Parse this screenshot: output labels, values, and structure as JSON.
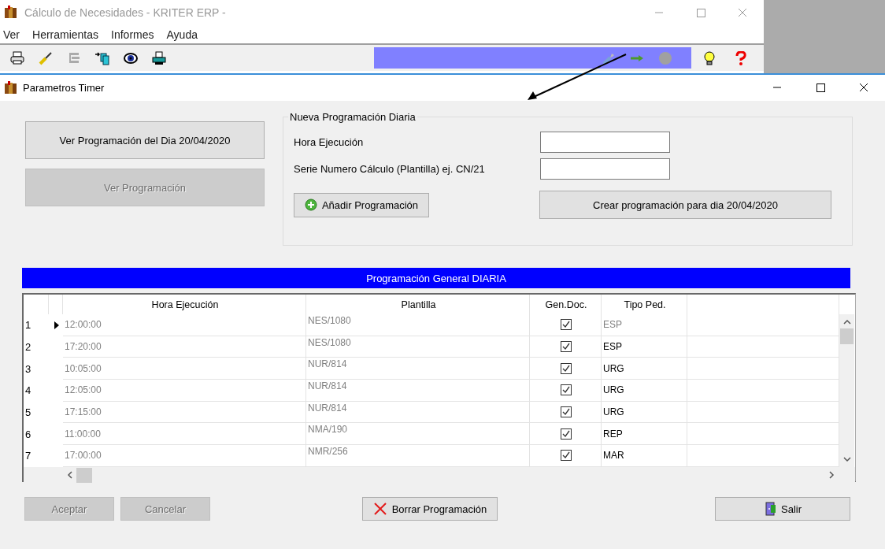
{
  "app": {
    "title": "Cálculo de Necesidades - KRITER ERP -",
    "menu": [
      {
        "label": "Ver"
      },
      {
        "label": "Herramientas"
      },
      {
        "label": "Informes"
      },
      {
        "label": "Ayuda"
      }
    ]
  },
  "dialog": {
    "title": "Parametros Timer",
    "left_buttons": [
      {
        "label": "Ver Programación del Dia 20/04/2020",
        "disabled": false
      },
      {
        "label": "Ver Programación",
        "disabled": true
      }
    ],
    "group": {
      "title": "Nueva Programación Diaria",
      "fields": [
        {
          "label": "Hora Ejecución"
        },
        {
          "label": "Serie Numero Cálculo (Plantilla) ej. CN/21"
        }
      ],
      "add_button": "Añadir Programación",
      "create_button": "Crear programación para dia  20/04/2020"
    }
  },
  "table": {
    "title": "Programación General DIARIA",
    "columns": [
      "Hora Ejecución",
      "Plantilla",
      "Gen.Doc.",
      "Tipo Ped."
    ],
    "rows": [
      {
        "number": "1",
        "selected": true,
        "hora": "12:00:00",
        "plantilla": "NES/1080",
        "gen_doc": true,
        "tipo": "ESP"
      },
      {
        "number": "2",
        "selected": false,
        "hora": "17:20:00",
        "plantilla": "NES/1080",
        "gen_doc": true,
        "tipo": "ESP"
      },
      {
        "number": "3",
        "selected": false,
        "hora": "10:05:00",
        "plantilla": "NUR/814",
        "gen_doc": true,
        "tipo": "URG"
      },
      {
        "number": "4",
        "selected": false,
        "hora": "12:05:00",
        "plantilla": "NUR/814",
        "gen_doc": true,
        "tipo": "URG"
      },
      {
        "number": "5",
        "selected": false,
        "hora": "17:15:00",
        "plantilla": "NUR/814",
        "gen_doc": true,
        "tipo": "URG"
      },
      {
        "number": "6",
        "selected": false,
        "hora": "11:00:00",
        "plantilla": "NMA/190",
        "gen_doc": true,
        "tipo": "REP"
      },
      {
        "number": "7",
        "selected": false,
        "hora": "17:00:00",
        "plantilla": "NMR/256",
        "gen_doc": true,
        "tipo": "MAR"
      }
    ]
  },
  "footer_buttons": [
    {
      "label": "Aceptar",
      "disabled": true,
      "kind": "plain"
    },
    {
      "label": "Cancelar",
      "disabled": true,
      "kind": "plain"
    },
    {
      "label": "Borrar Programación",
      "disabled": false,
      "kind": "delete"
    },
    {
      "label": "Salir",
      "disabled": false,
      "kind": "exit"
    }
  ]
}
